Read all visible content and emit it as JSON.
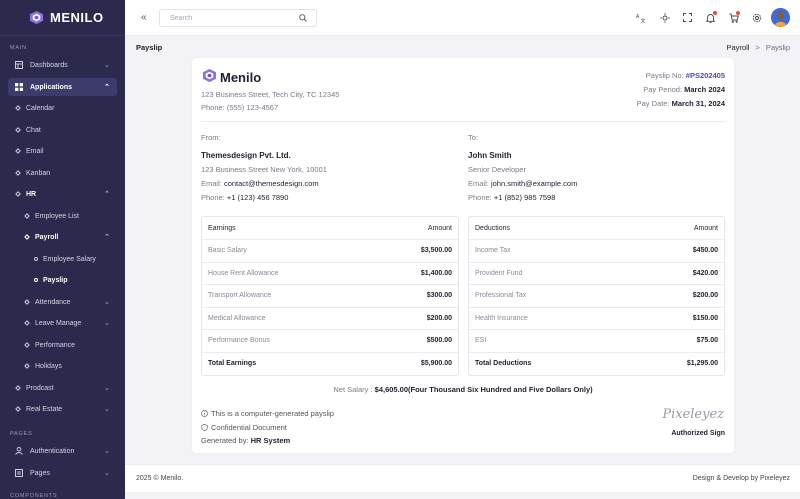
{
  "brand": {
    "name": "MENILO"
  },
  "sidebar": {
    "sections": {
      "main": "MAIN",
      "pages": "PAGES",
      "components": "COMPONENTS"
    },
    "items": [
      {
        "label": "Dashboards"
      },
      {
        "label": "Applications"
      },
      {
        "label": "Calendar"
      },
      {
        "label": "Chat"
      },
      {
        "label": "Email"
      },
      {
        "label": "Kanban"
      },
      {
        "label": "HR"
      },
      {
        "label": "Employee List"
      },
      {
        "label": "Payroll"
      },
      {
        "label": "Employee Salary"
      },
      {
        "label": "Payslip"
      },
      {
        "label": "Attendance"
      },
      {
        "label": "Leave Manage"
      },
      {
        "label": "Performance"
      },
      {
        "label": "Holidays"
      },
      {
        "label": "Prodcast"
      },
      {
        "label": "Real Estate"
      },
      {
        "label": "Authentication"
      },
      {
        "label": "Pages"
      }
    ]
  },
  "topbar": {
    "search_placeholder": "Search"
  },
  "page": {
    "title": "Payslip",
    "crumb_parent": "Payroll",
    "crumb_sep": ">",
    "crumb_current": "Payslip"
  },
  "payslip": {
    "company": "Menilo",
    "address": "123 Business Street, Tech City, TC 12345",
    "phone": "Phone: (555) 123-4567",
    "no_label": "Payslip No:",
    "no_value": "#PS202405",
    "period_label": "Pay Period:",
    "period_value": "March 2024",
    "date_label": "Pay Date:",
    "date_value": "March 31, 2024",
    "from": {
      "label": "From:",
      "name": "Themesdesign Pvt. Ltd.",
      "address": "123 Business Street New York, 10001",
      "email_label": "Email:",
      "email": "contact@themesdesign.com",
      "phone_label": "Phone:",
      "phone": "+1 (123) 456 7890"
    },
    "to": {
      "label": "To:",
      "name": "John Smith",
      "role": "Senior Developer",
      "email_label": "Email:",
      "email": "john.smith@example.com",
      "phone_label": "Phone:",
      "phone": "+1 (852) 985 7598"
    },
    "earnings": {
      "header": [
        "Earnings",
        "Amount"
      ],
      "rows": [
        [
          "Basic Salary",
          "$3,500.00"
        ],
        [
          "House Rent Allowance",
          "$1,400.00"
        ],
        [
          "Transport Allowance",
          "$300.00"
        ],
        [
          "Medical Allowance",
          "$200.00"
        ],
        [
          "Performance Bonus",
          "$500.00"
        ]
      ],
      "total": [
        "Total Earnings",
        "$5,900.00"
      ]
    },
    "deductions": {
      "header": [
        "Deductions",
        "Amount"
      ],
      "rows": [
        [
          "Income Tax",
          "$450.00"
        ],
        [
          "Provident Fund",
          "$420.00"
        ],
        [
          "Professional Tax",
          "$200.00"
        ],
        [
          "Health Insurance",
          "$150.00"
        ],
        [
          "ESI",
          "$75.00"
        ]
      ],
      "total": [
        "Total Deductions",
        "$1,295.00"
      ]
    },
    "net_label": "Net Salary :",
    "net_value": "$4,605.00(Four Thousand Six Hundred and Five Dollars Only)",
    "note1": "This is a computer-generated payslip",
    "note2": "Confidential Document",
    "generated_label": "Generated by:",
    "generated_value": "HR System",
    "signature": "Pixeleyez",
    "authorized": "Authorized Sign"
  },
  "footer": {
    "left": "2025 © Menilo.",
    "right": "Design & Develop by Pixeleyez"
  },
  "colors": {
    "sidebar": "#2b2a4c",
    "accent": "#4b49c9",
    "brand_purple": "#6f4fd6"
  }
}
